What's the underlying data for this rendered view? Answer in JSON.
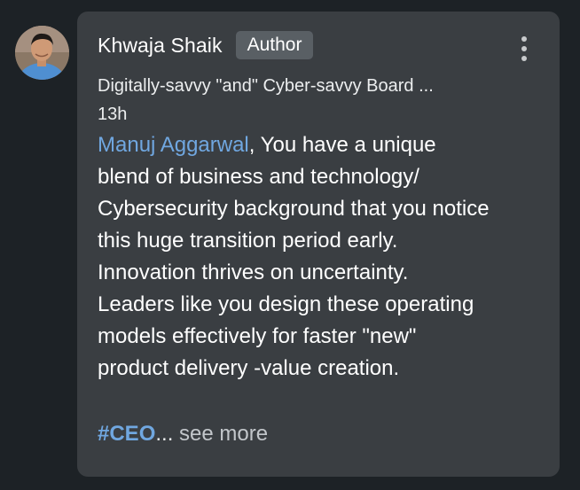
{
  "comment": {
    "author": {
      "name": "Khwaja Shaik",
      "badge": "Author",
      "headline": "Digitally-savvy \"and\" Cyber-savvy Board ...",
      "timestamp": "13h"
    },
    "menu_icon": "more-vertical-icon",
    "mention": "Manuj Aggarwal",
    "body_lines": [
      ", You have a unique",
      "blend of business and technology/",
      "Cybersecurity background that you notice",
      "this huge transition period early.",
      "Innovation thrives on uncertainty.",
      "Leaders like you design these operating",
      "models effectively for faster \"new\"",
      "product delivery -value creation."
    ],
    "hashtag": "#CEO",
    "truncation": "...",
    "see_more": "see more"
  },
  "colors": {
    "page_background": "#1d2226",
    "bubble_background": "#3a3e42",
    "badge_background": "#595f64",
    "link": "#70a7e0",
    "text": "#ffffff"
  }
}
